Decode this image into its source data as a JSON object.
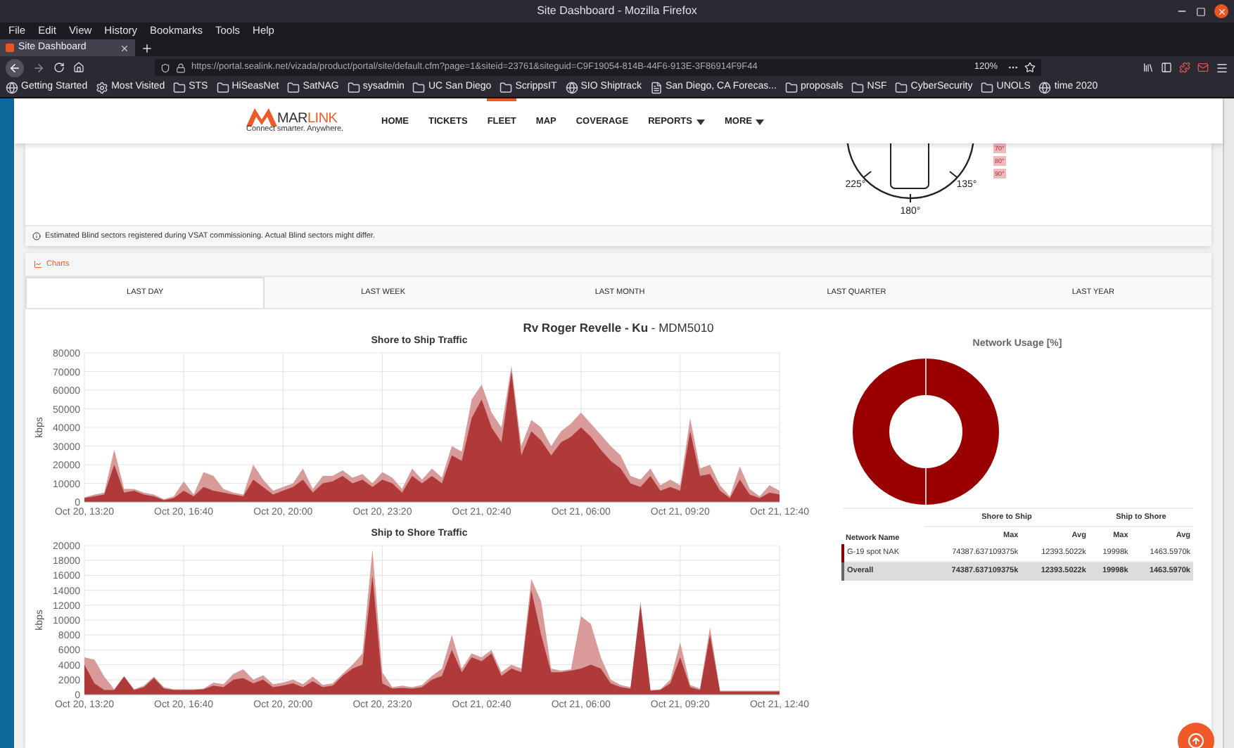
{
  "window": {
    "title": "Site Dashboard - Mozilla Firefox"
  },
  "menu_bar": [
    "File",
    "Edit",
    "View",
    "History",
    "Bookmarks",
    "Tools",
    "Help"
  ],
  "browser_tabs": [
    {
      "label": "Site Dashboard",
      "selected": true
    }
  ],
  "address_bar": {
    "url": "https://portal.sealink.net/vizada/product/portal/site/default.cfm?page=1&siteid=23761&siteguid=C9F19054-814B-44F6-913E-3F86914F9F44",
    "zoom": "120%"
  },
  "bookmarks": [
    {
      "label": "Getting Started",
      "kind": "globe"
    },
    {
      "label": "Most Visited",
      "kind": "gear"
    },
    {
      "label": "STS",
      "kind": "folder"
    },
    {
      "label": "HiSeasNet",
      "kind": "folder"
    },
    {
      "label": "SatNAG",
      "kind": "folder"
    },
    {
      "label": "sysadmin",
      "kind": "folder"
    },
    {
      "label": "UC San Diego",
      "kind": "folder"
    },
    {
      "label": "ScrippsIT",
      "kind": "folder"
    },
    {
      "label": "SIO Shiptrack",
      "kind": "globe"
    },
    {
      "label": "San Diego, CA Forecas...",
      "kind": "page"
    },
    {
      "label": "proposals",
      "kind": "folder"
    },
    {
      "label": "NSF",
      "kind": "folder"
    },
    {
      "label": "CyberSecurity",
      "kind": "folder"
    },
    {
      "label": "UNOLS",
      "kind": "folder"
    },
    {
      "label": "time 2020",
      "kind": "globe"
    }
  ],
  "nav": {
    "logo": {
      "part1": "MAR",
      "part2": "LINK",
      "tagline": "Connect smarter. Anywhere."
    },
    "items": [
      {
        "label": "HOME",
        "selected": false,
        "dropdown": false
      },
      {
        "label": "TICKETS",
        "selected": false,
        "dropdown": false
      },
      {
        "label": "FLEET",
        "selected": true,
        "dropdown": false
      },
      {
        "label": "MAP",
        "selected": false,
        "dropdown": false
      },
      {
        "label": "COVERAGE",
        "selected": false,
        "dropdown": false
      },
      {
        "label": "REPORTS",
        "selected": false,
        "dropdown": true
      },
      {
        "label": "MORE",
        "selected": false,
        "dropdown": true
      }
    ]
  },
  "blind_sectors": {
    "compass_labels": [
      "225°",
      "135°",
      "180°"
    ],
    "badges": [
      "70°",
      "80°",
      "90°"
    ],
    "note": "Estimated Blind sectors registered during VSAT commissioning. Actual Blind sectors might differ."
  },
  "charts_panel": {
    "header": "Charts",
    "tabs": [
      {
        "label": "LAST DAY",
        "selected": true
      },
      {
        "label": "LAST WEEK",
        "selected": false
      },
      {
        "label": "LAST MONTH",
        "selected": false
      },
      {
        "label": "LAST QUARTER",
        "selected": false
      },
      {
        "label": "LAST YEAR",
        "selected": false
      }
    ],
    "title": "**Rv Roger Revelle - Ku** - MDM5010",
    "traffic_charts": [
      {
        "chart_data": {
          "type": "area",
          "title": "Shore to Ship Traffic",
          "ylabel": "kbps",
          "grid": true,
          "ylim": [
            0,
            80000
          ],
          "yticks": [
            0,
            10000,
            20000,
            30000,
            40000,
            50000,
            60000,
            70000,
            80000
          ],
          "categories": [
            "Oct 20, 13:20",
            null,
            null,
            null,
            null,
            null,
            null,
            null,
            null,
            null,
            "Oct 20, 16:40",
            null,
            null,
            null,
            null,
            null,
            null,
            null,
            null,
            null,
            "Oct 20, 20:00",
            null,
            null,
            null,
            null,
            null,
            null,
            null,
            null,
            null,
            "Oct 20, 23:20",
            null,
            null,
            null,
            null,
            null,
            null,
            null,
            null,
            null,
            "Oct 21, 02:40",
            null,
            null,
            null,
            null,
            null,
            null,
            null,
            null,
            null,
            "Oct 21, 06:00",
            null,
            null,
            null,
            null,
            null,
            null,
            null,
            null,
            null,
            "Oct 21, 09:20",
            null,
            null,
            null,
            null,
            null,
            null,
            null,
            null,
            null,
            "Oct 21, 12:40"
          ],
          "series": [
            {
              "color": "#d99a9a",
              "values": [
                2500,
                4000,
                5000,
                28000,
                7000,
                7000,
                5000,
                4000,
                1500,
                3000,
                11000,
                4000,
                16000,
                14000,
                7000,
                5000,
                4000,
                20000,
                12000,
                6000,
                8000,
                10000,
                18000,
                7000,
                14000,
                14000,
                17000,
                13000,
                15000,
                10000,
                16000,
                13000,
                7000,
                18000,
                12000,
                18000,
                13000,
                30000,
                27000,
                55000,
                63000,
                48000,
                40000,
                73000,
                30000,
                44000,
                40000,
                30000,
                38000,
                42000,
                48000,
                42000,
                36000,
                30000,
                25000,
                14000,
                12000,
                18000,
                9000,
                12000,
                9000,
                45000,
                18000,
                20000,
                9000,
                3000,
                19000,
                7000,
                3000,
                9000,
                6000
              ]
            },
            {
              "color": "#b03a3a",
              "values": [
                2000,
                3000,
                4000,
                20000,
                5000,
                6000,
                4000,
                3000,
                1000,
                2000,
                6000,
                3000,
                8000,
                6000,
                5000,
                4000,
                3000,
                12000,
                8000,
                4000,
                6000,
                8000,
                12000,
                5000,
                10000,
                11000,
                14000,
                10000,
                12000,
                8000,
                12000,
                10000,
                5000,
                14000,
                10000,
                14000,
                10000,
                25000,
                22000,
                45000,
                55000,
                40000,
                32000,
                70000,
                25000,
                38000,
                33000,
                25000,
                32000,
                35000,
                40000,
                35000,
                28000,
                22000,
                18000,
                10000,
                8000,
                14000,
                6000,
                8000,
                6000,
                38000,
                14000,
                15000,
                6000,
                2000,
                12000,
                4000,
                2000,
                5000,
                4000
              ]
            }
          ]
        }
      },
      {
        "chart_data": {
          "type": "area",
          "title": "Ship to Shore Traffic",
          "ylabel": "kbps",
          "grid": true,
          "ylim": [
            0,
            20000
          ],
          "yticks": [
            0,
            2000,
            4000,
            6000,
            8000,
            10000,
            12000,
            14000,
            16000,
            18000,
            20000
          ],
          "categories": [
            "Oct 20, 13:20",
            null,
            null,
            null,
            null,
            null,
            null,
            null,
            null,
            null,
            "Oct 20, 16:40",
            null,
            null,
            null,
            null,
            null,
            null,
            null,
            null,
            null,
            "Oct 20, 20:00",
            null,
            null,
            null,
            null,
            null,
            null,
            null,
            null,
            null,
            "Oct 20, 23:20",
            null,
            null,
            null,
            null,
            null,
            null,
            null,
            null,
            null,
            "Oct 21, 02:40",
            null,
            null,
            null,
            null,
            null,
            null,
            null,
            null,
            null,
            "Oct 21, 06:00",
            null,
            null,
            null,
            null,
            null,
            null,
            null,
            null,
            null,
            "Oct 21, 09:20",
            null,
            null,
            null,
            null,
            null,
            null,
            null,
            null,
            null,
            "Oct 21, 12:40"
          ],
          "series": [
            {
              "color": "#d99a9a",
              "values": [
                5000,
                4700,
                2400,
                700,
                2500,
                700,
                1200,
                2400,
                1000,
                700,
                700,
                700,
                800,
                1600,
                1400,
                2800,
                3400,
                2000,
                2600,
                1400,
                1600,
                2000,
                1400,
                2400,
                1300,
                1500,
                2800,
                4000,
                5500,
                19500,
                3000,
                1000,
                1200,
                1000,
                1300,
                2500,
                3500,
                8000,
                3500,
                5500,
                5000,
                6000,
                3000,
                4000,
                3500,
                15500,
                12500,
                3500,
                3200,
                3400,
                10500,
                9500,
                5000,
                2000,
                1300,
                1000,
                12500,
                600,
                700,
                2000,
                7000,
                1300,
                800,
                9000,
                500,
                500,
                500,
                500,
                500,
                500,
                500
              ]
            },
            {
              "color": "#b03a3a",
              "values": [
                4000,
                1500,
                600,
                600,
                2400,
                600,
                1000,
                2200,
                800,
                600,
                600,
                600,
                700,
                1200,
                1000,
                2000,
                2200,
                1500,
                2000,
                1000,
                1200,
                1500,
                1000,
                1800,
                1000,
                1200,
                2500,
                3500,
                4000,
                16000,
                1500,
                800,
                900,
                800,
                1000,
                2000,
                2500,
                6000,
                3000,
                5000,
                4500,
                5500,
                2500,
                3500,
                3000,
                14000,
                8000,
                3000,
                3000,
                3200,
                3500,
                4000,
                3500,
                1500,
                1000,
                800,
                12000,
                500,
                600,
                1500,
                5000,
                1000,
                600,
                8000,
                400,
                400,
                400,
                400,
                400,
                400,
                400
              ]
            }
          ]
        }
      }
    ],
    "network_usage": {
      "title": "Network Usage [%]",
      "table": {
        "name_header": "Network Name",
        "groups": [
          "Shore to Ship",
          "Ship to Shore"
        ],
        "subheaders": [
          "Max",
          "Avg",
          "Max",
          "Avg"
        ],
        "rows": [
          {
            "kind": "network",
            "color": "#8b0000",
            "cells": [
              "G-19 spot NAK",
              "74387.637109375k",
              "12393.5022k",
              "19998k",
              "1463.5970k"
            ]
          },
          {
            "kind": "total",
            "cells": [
              "Overall",
              "74387.637109375k",
              "12393.5022k",
              "19998k",
              "1463.5970k"
            ]
          }
        ]
      }
    }
  }
}
